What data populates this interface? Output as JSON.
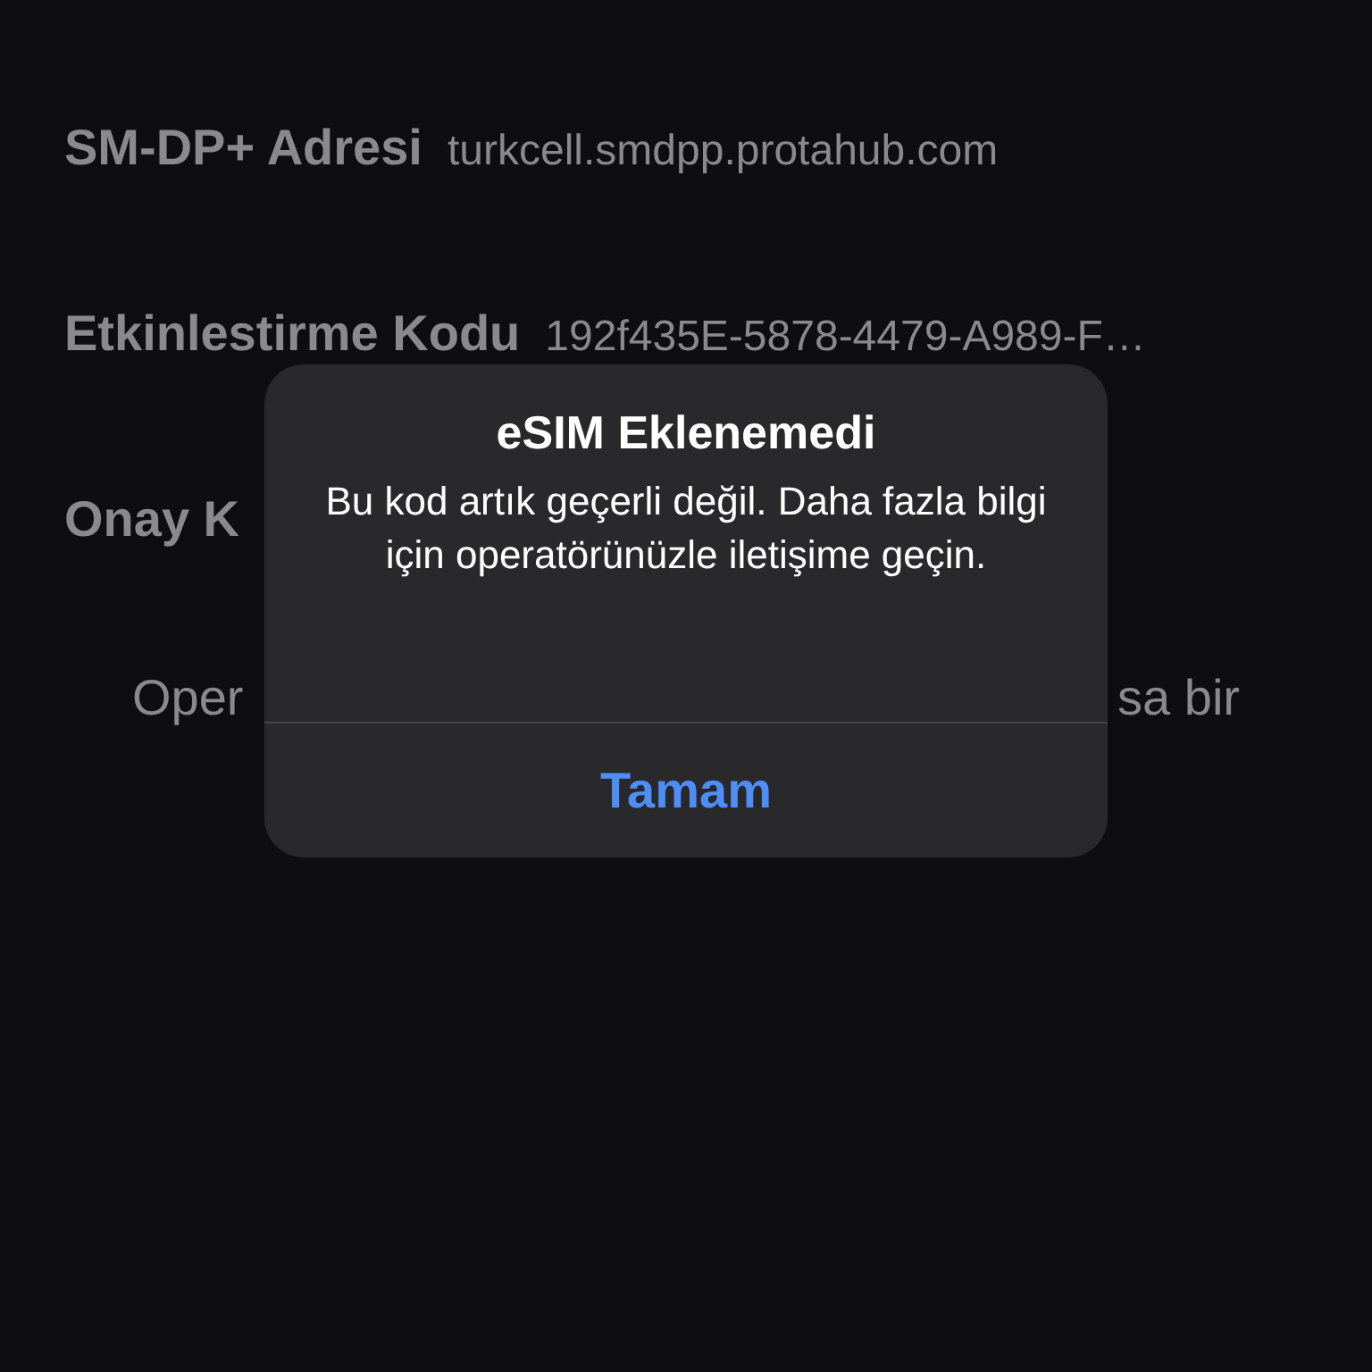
{
  "settings": [
    {
      "label": "SM-DP+ Adresi",
      "value": "turkcell.smdpp.protahub.com"
    },
    {
      "label": "Etkinlestirme Kodu",
      "value": "192f435E-5878-4479-A989-F…"
    },
    {
      "label": "Onay K"
    }
  ],
  "note": {
    "left": "Oper",
    "right": "sa bir"
  },
  "alert": {
    "title": "eSIM Eklenemedi",
    "message": "Bu kod artık geçerli değil. Daha fazla bilgi için operatörünüzle iletişime geçin.",
    "buttons": [
      "Tamam"
    ]
  }
}
